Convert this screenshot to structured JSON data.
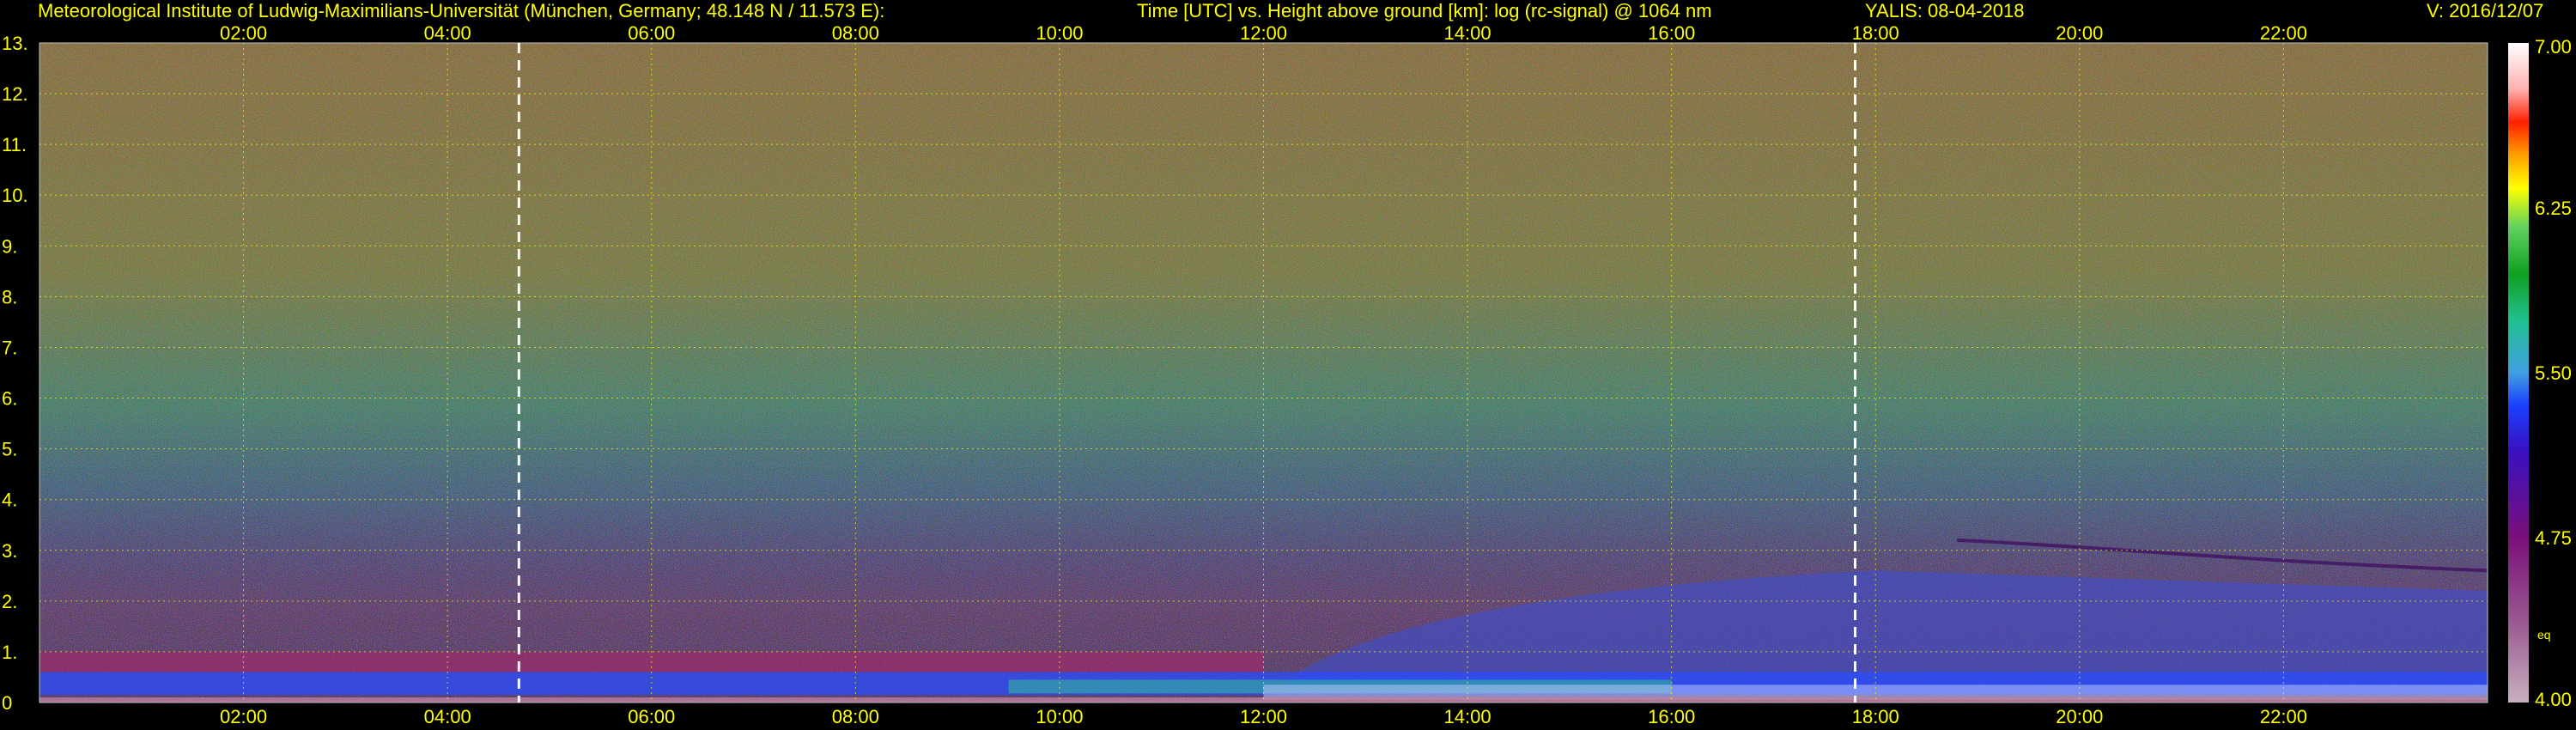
{
  "header": {
    "institute": "Meteorological Institute of Ludwig-Maximilians-Universität (München, Germany; 48.148 N / 11.573 E):",
    "plot_description": "Time [UTC] vs. Height above ground [km]: log (rc-signal) @ 1064 nm",
    "instrument": "YALIS: 08-04-2018",
    "version": "V: 2016/12/07"
  },
  "chart_data": {
    "type": "heatmap",
    "title": "Time [UTC] vs. Height above ground [km]: log (rc-signal) @ 1064 nm",
    "x_tick_labels": [
      "02:00",
      "04:00",
      "06:00",
      "08:00",
      "10:00",
      "12:00",
      "14:00",
      "16:00",
      "18:00",
      "20:00",
      "22:00"
    ],
    "x_tick_hours": [
      2,
      4,
      6,
      8,
      10,
      12,
      14,
      16,
      18,
      20,
      22
    ],
    "xlim": [
      0,
      24
    ],
    "y_tick_labels": [
      "0",
      "1.",
      "2.",
      "3.",
      "4.",
      "5.",
      "6.",
      "7.",
      "8.",
      "9.",
      "10.",
      "11.",
      "12.",
      "13."
    ],
    "y_tick_values": [
      0,
      1,
      2,
      3,
      4,
      5,
      6,
      7,
      8,
      9,
      10,
      11,
      12,
      13
    ],
    "ylim": [
      0,
      13
    ],
    "grid": true,
    "vertical_markers_hours": [
      4.7,
      17.8
    ],
    "colorbar": {
      "range": [
        4.0,
        7.0
      ],
      "tick_labels": [
        "4.00",
        "4.75",
        "5.50",
        "6.25",
        "7.00"
      ],
      "tick_values": [
        4.0,
        4.75,
        5.5,
        6.25,
        7.0
      ],
      "note": "eq"
    }
  }
}
